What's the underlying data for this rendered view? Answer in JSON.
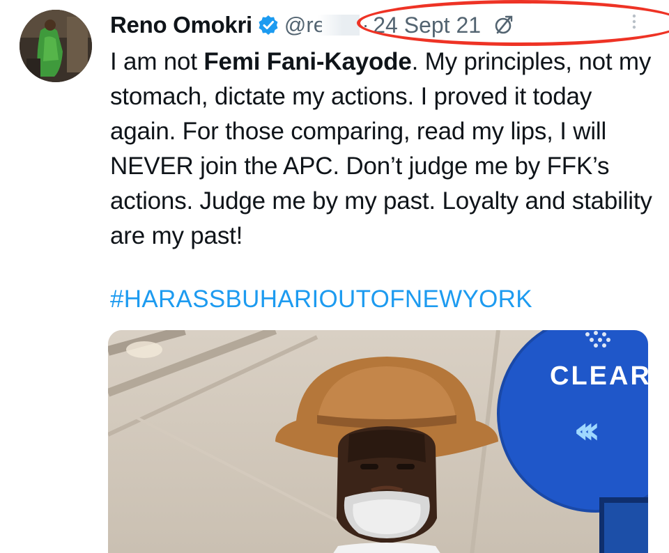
{
  "author": {
    "display_name": "Reno Omokri",
    "handle": "@re",
    "verified": true
  },
  "meta": {
    "separator": "·",
    "timestamp": "24 Sept 21"
  },
  "tweet": {
    "text_bold_prefix": "I am not ",
    "text_bold": "Femi Fani-Kayode",
    "text_rest": ". My principles, not my stomach, dictate my actions. I proved it today again. For those comparing, read my lips, I will NEVER join the APC. Don’t judge me by FFK’s actions. Judge me by my past. Loyalty and stability are my past!",
    "hashtag": "#HARASSBUHARIOUTOFNEWYORK"
  },
  "media": {
    "sign_text": "CLEAR",
    "sign_arrows": "‹‹‹"
  },
  "colors": {
    "link": "#1d9bf0",
    "verified": "#1d9bf0",
    "annotation": "#ee3325",
    "sign": "#1f57c9"
  }
}
